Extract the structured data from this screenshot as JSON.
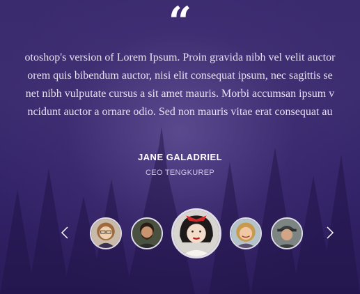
{
  "testimonial": {
    "quote_lines": [
      "otoshop's version  of Lorem Ipsum. Proin gravida nibh vel velit auctor",
      "orem quis bibendum auctor, nisi elit consequat ipsum, nec sagittis se",
      "net nibh vulputate cursus a sit amet mauris. Morbi accumsan ipsum v",
      "ncidunt auctor a ornare odio. Sed non  mauris vitae erat consequat au"
    ],
    "name": "JANE GALADRIEL",
    "role": "CEO TENGKUREP"
  },
  "carousel": {
    "prev_icon": "chevron-left-icon",
    "next_icon": "chevron-right-icon",
    "active_index": 2,
    "avatar_count": 5
  },
  "colors": {
    "background": "#34246a",
    "text": "#ffffff",
    "muted_text": "#cfc6e6"
  }
}
